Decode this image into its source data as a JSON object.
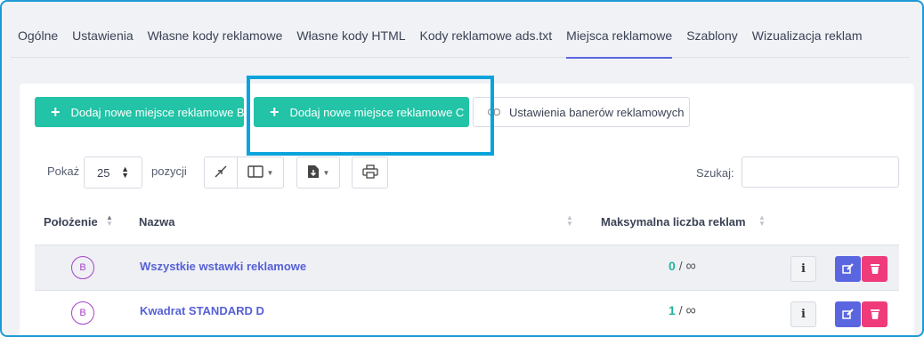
{
  "tabs": [
    {
      "label": "Ogólne"
    },
    {
      "label": "Ustawienia"
    },
    {
      "label": "Własne kody reklamowe"
    },
    {
      "label": "Własne kody HTML"
    },
    {
      "label": "Kody reklamowe ads.txt"
    },
    {
      "label": "Miejsca reklamowe",
      "active": true
    },
    {
      "label": "Szablony"
    },
    {
      "label": "Wizualizacja reklam"
    }
  ],
  "toolbar": {
    "add_b_label": "Dodaj nowe miejsce reklamowe B",
    "add_c_label": "Dodaj nowe miejsce reklamowe C",
    "banner_settings_label": "Ustawienia banerów reklamowych"
  },
  "controls": {
    "show_label": "Pokaż",
    "page_size": "25",
    "positions_label": "pozycji",
    "search_label": "Szukaj:",
    "search_value": ""
  },
  "table": {
    "columns": [
      "Położenie",
      "Nazwa",
      "Maksymalna liczba reklam"
    ],
    "rows": [
      {
        "position": "B",
        "name": "Wszystkie wstawki reklamowe",
        "count": "0",
        "sep": "/",
        "max": "∞"
      },
      {
        "position": "B",
        "name": "Kwadrat STANDARD D",
        "count": "1",
        "sep": "/",
        "max": "∞"
      }
    ]
  },
  "icons": {
    "plus": "+",
    "link": "link-icon",
    "info": "i",
    "edit": "edit-icon",
    "delete": "trash-icon"
  },
  "colors": {
    "accent": "#5a66e0",
    "teal": "#22c3a6",
    "danger": "#ef3b7a",
    "highlight": "#0aa3dc",
    "badge": "#a742c9"
  }
}
